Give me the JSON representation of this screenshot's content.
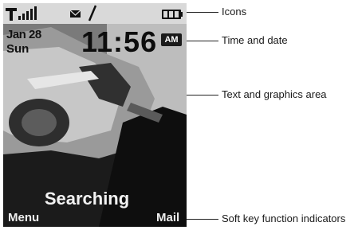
{
  "screen": {
    "date": "Jan 28",
    "day": "Sun",
    "time": "11:56",
    "ampm": "AM",
    "status_message": "Searching",
    "softkey_left": "Menu",
    "softkey_right": "Mail",
    "status_icons": [
      "signal-strength-icon",
      "roaming-icon",
      "message-icon",
      "battery-icon"
    ],
    "wallpaper": "car-photo"
  },
  "callouts": {
    "icons": "Icons",
    "time_and_date": "Time and date",
    "text_graphics_area": "Text and graphics area",
    "softkey_indicators": "Soft key function indicators"
  }
}
